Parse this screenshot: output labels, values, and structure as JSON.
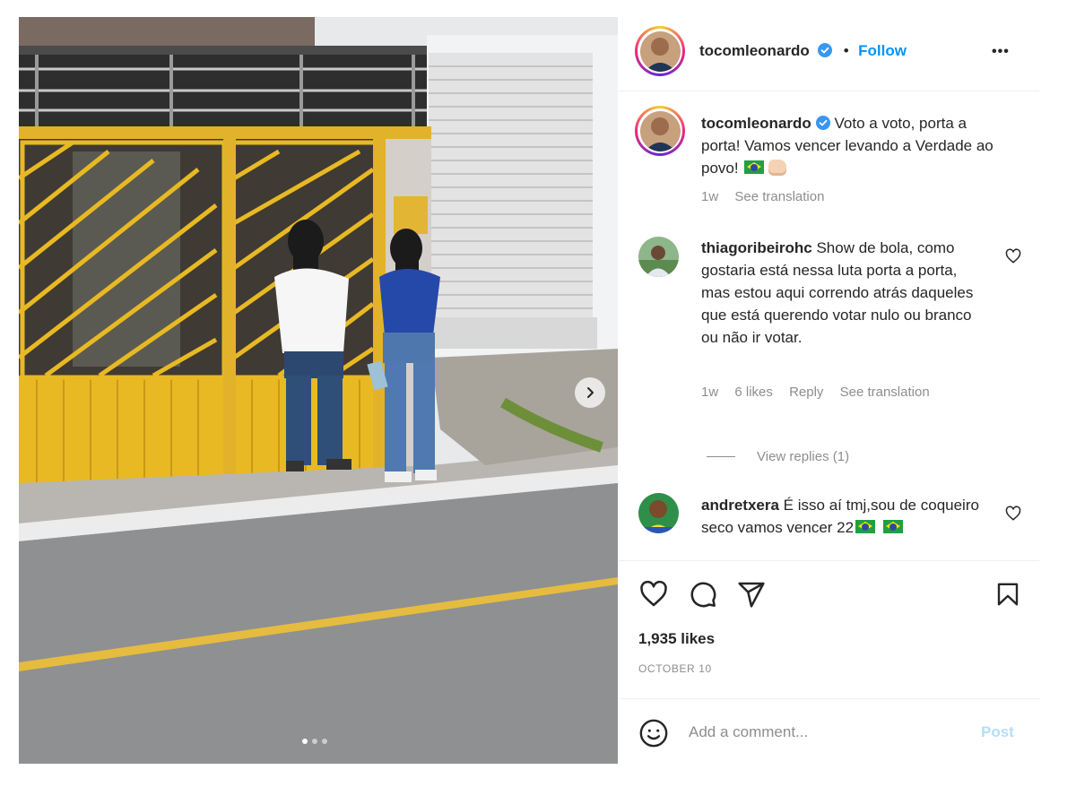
{
  "post": {
    "author": "tocomleonardo",
    "follow_label": "Follow",
    "more_label": "•••",
    "bullet": "•",
    "carousel": {
      "slides": 3,
      "active": 0
    },
    "caption": {
      "username": "tocomleonardo",
      "text": "Voto a voto, porta a porta! Vamos vencer levando a Verdade ao povo!",
      "emojis": [
        "brazil-flag",
        "raised-fist"
      ],
      "time": "1w",
      "see_translation": "See translation"
    },
    "comments": [
      {
        "username": "thiagoribeirohc",
        "text": "Show de bola, como gostaria está nessa luta porta a porta, mas estou aqui correndo atrás daqueles que está querendo votar nulo ou branco ou não ir votar.",
        "time": "1w",
        "likes": "6 likes",
        "reply": "Reply",
        "see_translation": "See translation",
        "view_replies": "View replies (1)"
      },
      {
        "username": "andretxera",
        "text": "É isso aí tmj,sou de coqueiro seco vamos vencer 22",
        "emojis": [
          "brazil-flag",
          "brazil-flag"
        ]
      }
    ],
    "likes": "1,935 likes",
    "date": "OCTOBER 10",
    "comment_placeholder": "Add a comment...",
    "post_label": "Post"
  },
  "colors": {
    "accent": "#0095f6",
    "text": "#262626",
    "muted": "#8e8e8e",
    "post_disabled": "#b2dffc",
    "gate_yellow": "#e8b923"
  },
  "icons": [
    "verified-badge-icon",
    "more-options-icon",
    "heart-icon",
    "comment-icon",
    "share-icon",
    "bookmark-icon",
    "emoji-icon",
    "chevron-right-icon"
  ]
}
